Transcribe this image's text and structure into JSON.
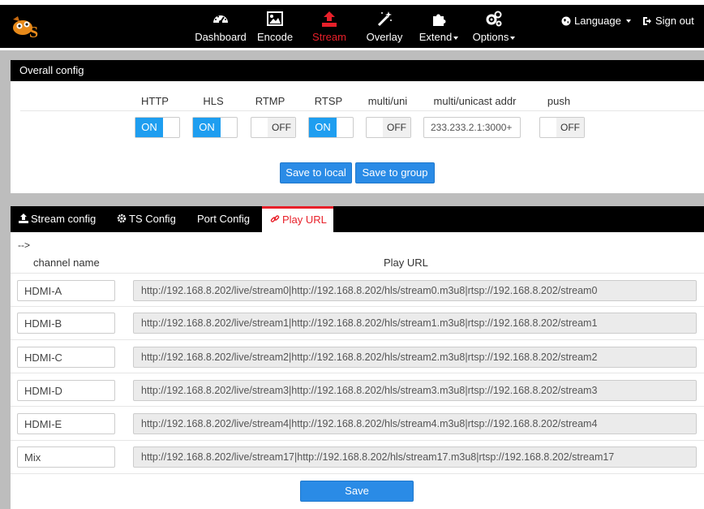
{
  "nav": {
    "items": [
      {
        "label": "Dashboard",
        "icon": "dashboard-icon"
      },
      {
        "label": "Encode",
        "icon": "image-icon"
      },
      {
        "label": "Stream",
        "icon": "upload-icon",
        "active": true
      },
      {
        "label": "Overlay",
        "icon": "magic-wand-icon"
      },
      {
        "label": "Extend",
        "icon": "puzzle-icon"
      },
      {
        "label": "Options",
        "icon": "gears-icon"
      }
    ],
    "language": "Language",
    "signout": "Sign out"
  },
  "overall": {
    "title": "Overall config",
    "columns": [
      "HTTP",
      "HLS",
      "RTMP",
      "RTSP",
      "multi/uni",
      "multi/unicast addr",
      "push"
    ],
    "toggles": {
      "http": {
        "on": "ON",
        "off": "",
        "state": true
      },
      "hls": {
        "on": "ON",
        "off": "",
        "state": true
      },
      "rtmp": {
        "on": "",
        "off": "OFF",
        "state": false
      },
      "rtsp": {
        "on": "ON",
        "off": "",
        "state": true
      },
      "multi": {
        "on": "",
        "off": "OFF",
        "state": false
      },
      "push": {
        "on": "",
        "off": "OFF",
        "state": false
      }
    },
    "addr_value": "233.233.2.1:3000+",
    "save_local": "Save to local",
    "save_group": "Save to group"
  },
  "tabs": [
    {
      "label": "Stream config",
      "icon": "upload-icon"
    },
    {
      "label": "TS Config",
      "icon": "gear-icon"
    },
    {
      "label": "Port Config",
      "icon": ""
    },
    {
      "label": "Play URL",
      "icon": "link-icon",
      "active": true
    }
  ],
  "playurl": {
    "stray_text": "-->",
    "header_channel": "channel name",
    "header_url": "Play URL",
    "rows": [
      {
        "name": "HDMI-A",
        "url": "http://192.168.8.202/live/stream0|http://192.168.8.202/hls/stream0.m3u8|rtsp://192.168.8.202/stream0"
      },
      {
        "name": "HDMI-B",
        "url": "http://192.168.8.202/live/stream1|http://192.168.8.202/hls/stream1.m3u8|rtsp://192.168.8.202/stream1"
      },
      {
        "name": "HDMI-C",
        "url": "http://192.168.8.202/live/stream2|http://192.168.8.202/hls/stream2.m3u8|rtsp://192.168.8.202/stream2"
      },
      {
        "name": "HDMI-D",
        "url": "http://192.168.8.202/live/stream3|http://192.168.8.202/hls/stream3.m3u8|rtsp://192.168.8.202/stream3"
      },
      {
        "name": "HDMI-E",
        "url": "http://192.168.8.202/live/stream4|http://192.168.8.202/hls/stream4.m3u8|rtsp://192.168.8.202/stream4"
      },
      {
        "name": "Mix",
        "url": "http://192.168.8.202/live/stream17|http://192.168.8.202/hls/stream17.m3u8|rtsp://192.168.8.202/stream17"
      }
    ],
    "save": "Save"
  },
  "colors": {
    "accent_blue": "#1e9ef0",
    "active_red": "#e8202a",
    "navbar": "#000000"
  }
}
